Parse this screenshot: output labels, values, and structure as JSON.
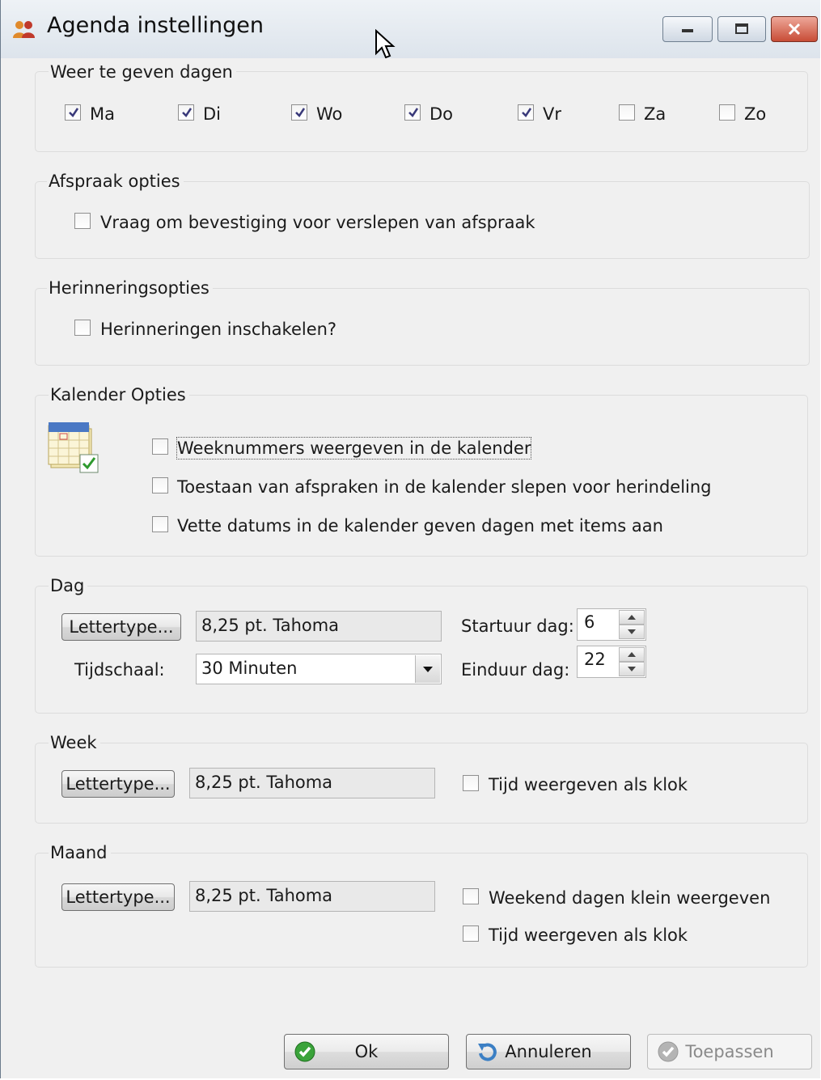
{
  "window": {
    "title": "Agenda instellingen",
    "controls": [
      "minimize",
      "maximize",
      "close"
    ]
  },
  "days_group": {
    "title": "Weer te geven dagen",
    "days": [
      {
        "label": "Ma",
        "checked": true
      },
      {
        "label": "Di",
        "checked": true
      },
      {
        "label": "Wo",
        "checked": true
      },
      {
        "label": "Do",
        "checked": true
      },
      {
        "label": "Vr",
        "checked": true
      },
      {
        "label": "Za",
        "checked": false
      },
      {
        "label": "Zo",
        "checked": false
      }
    ]
  },
  "appointment_group": {
    "title": "Afspraak opties",
    "confirm_drag": {
      "label": "Vraag om bevestiging voor verslepen van afspraak",
      "checked": false
    }
  },
  "reminder_group": {
    "title": "Herinneringsopties",
    "enable": {
      "label": "Herinneringen inschakelen?",
      "checked": false
    }
  },
  "calendar_group": {
    "title": "Kalender Opties",
    "icon": "calendar-check-icon",
    "options": [
      {
        "label": "Weeknummers weergeven in de kalender",
        "checked": false
      },
      {
        "label": "Toestaan van afspraken in de kalender slepen voor herindeling",
        "checked": false
      },
      {
        "label": "Vette datums in de kalender geven dagen met items aan",
        "checked": false
      }
    ]
  },
  "day_group": {
    "title": "Dag",
    "font_button": "Lettertype...",
    "font_value": "8,25 pt. Tahoma",
    "timescale_label": "Tijdschaal:",
    "timescale_value": "30 Minuten",
    "start_label": "Startuur dag:",
    "start_value": "6",
    "end_label": "Einduur dag:",
    "end_value": "22"
  },
  "week_group": {
    "title": "Week",
    "font_button": "Lettertype...",
    "font_value": "8,25 pt. Tahoma",
    "clock": {
      "label": "Tijd weergeven als klok",
      "checked": false
    }
  },
  "month_group": {
    "title": "Maand",
    "font_button": "Lettertype...",
    "font_value": "8,25 pt. Tahoma",
    "weekend_small": {
      "label": "Weekend dagen klein weergeven",
      "checked": false
    },
    "clock": {
      "label": "Tijd weergeven als klok",
      "checked": false
    }
  },
  "footer": {
    "ok": "Ok",
    "cancel": "Annuleren",
    "apply": "Toepassen"
  },
  "colors": {
    "ok_icon": "#3aa33a",
    "cancel_icon": "#3b7fc4",
    "apply_icon_disabled": "#a8a8a8",
    "close_button": "#c84c36"
  }
}
